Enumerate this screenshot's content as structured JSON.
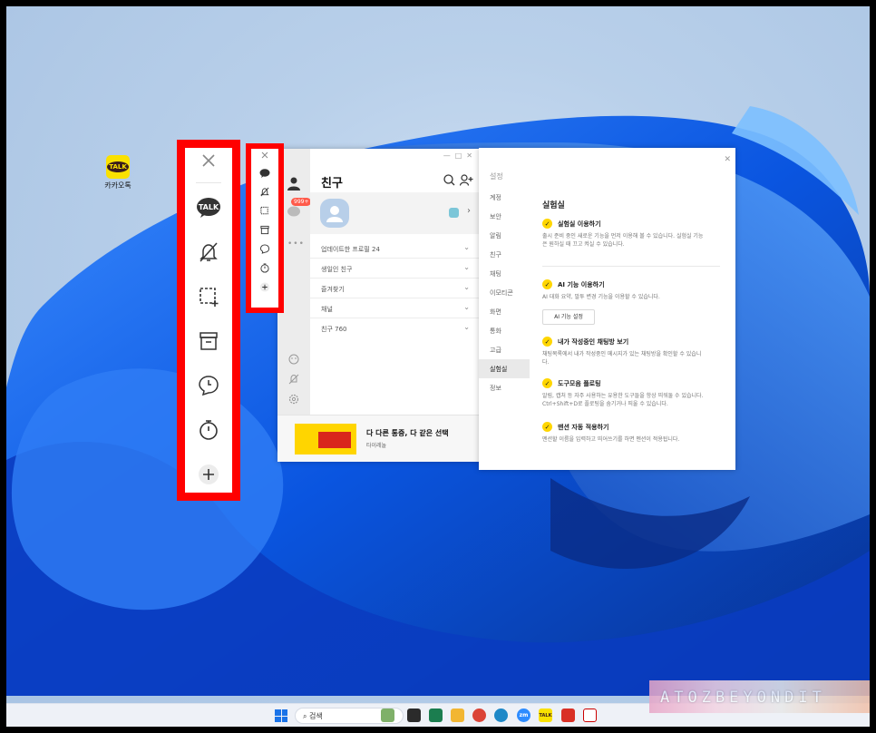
{
  "desktop": {
    "icon_label": "카카오톡",
    "icon_badge": "TALK"
  },
  "toolbar_big": {
    "icons": [
      "close-icon",
      "talk-icon",
      "mute-bell-icon",
      "capture-icon",
      "archive-icon",
      "chat-clock-icon",
      "timer-icon",
      "add-icon"
    ],
    "talk_label": "TALK"
  },
  "kakao": {
    "title": "친구",
    "badge": "999+",
    "sections": [
      {
        "label": "업데이트한 프로필",
        "count": "24"
      },
      {
        "label": "생일인 친구",
        "count": ""
      },
      {
        "label": "즐겨찾기",
        "count": ""
      },
      {
        "label": "채널",
        "count": ""
      },
      {
        "label": "친구",
        "count": "760"
      }
    ],
    "ad": {
      "title": "다 다른 통증, 다 같은 선택",
      "subtitle": "타이레놀"
    }
  },
  "settings": {
    "title": "설정",
    "nav": [
      "계정",
      "보안",
      "알림",
      "친구",
      "채팅",
      "이모티콘",
      "화면",
      "통화",
      "고급",
      "실험실",
      "정보"
    ],
    "active_nav": "실험실",
    "heading": "실험실",
    "options": [
      {
        "title": "실험실 이용하기",
        "desc": "출시 준비 중인 새로운 기능을 먼저 이용해 볼 수 있습니다. 실험실 기능은 원하실 때 끄고 켜실 수 있습니다."
      },
      {
        "title": "AI 기능 이용하기",
        "desc": "AI 대화 요약, 말투 변경 기능을 이용할 수 있습니다."
      },
      {
        "title": "내가 작성중인 채팅방 보기",
        "desc": "채팅목록에서 내가 작성중인 메시지가 있는 채팅방을 확인할 수 있습니다."
      },
      {
        "title": "도구모음 플로팅",
        "desc": "알림, 캡처 등 자주 사용하는 유용한 도구들을 항상 띄워둘 수 있습니다. Ctrl+Shift+D로 플로팅을 숨기거나 띄울 수 있습니다."
      },
      {
        "title": "맨션 자동 적용하기",
        "desc": "멘션할 이름을 입력하고 띄어쓰기를 하면 멘션이 적용됩니다."
      }
    ],
    "ai_button": "AI 기능 설정"
  },
  "taskbar": {
    "search_placeholder": "검색",
    "apps": [
      "widgets",
      "task-view",
      "store",
      "file-explorer",
      "chrome",
      "edge",
      "zoom",
      "kakaotalk",
      "app-red",
      "snipping-tool"
    ],
    "zoom_label": "zm",
    "kakao_label": "TALK"
  },
  "watermark": "ATOZBEYONDIT",
  "colors": {
    "highlight": "#ff0000",
    "kakao_yellow": "#fae100",
    "check_yellow": "#ffd600",
    "wallpaper_blue": "#1e6cf0"
  }
}
